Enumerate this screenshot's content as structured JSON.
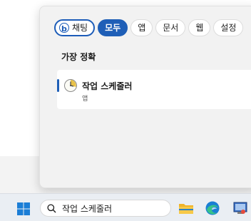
{
  "filters": [
    {
      "label": "채팅",
      "icon": "bing-icon",
      "state": "outlined"
    },
    {
      "label": "모두",
      "state": "selected"
    },
    {
      "label": "앱"
    },
    {
      "label": "문서"
    },
    {
      "label": "웹"
    },
    {
      "label": "설정"
    }
  ],
  "best_match": {
    "heading": "가장 정확",
    "name": "작업 스케줄러",
    "type": "앱",
    "icon": "task-scheduler-icon"
  },
  "taskbar": {
    "search_value": "작업 스케줄러",
    "icons": [
      "windows-start-icon",
      "file-explorer-icon",
      "edge-browser-icon",
      "app-icon"
    ]
  },
  "colors": {
    "accent": "#1f5fb7",
    "panel": "#f2f2f2",
    "taskbar": "#eaeef3"
  }
}
